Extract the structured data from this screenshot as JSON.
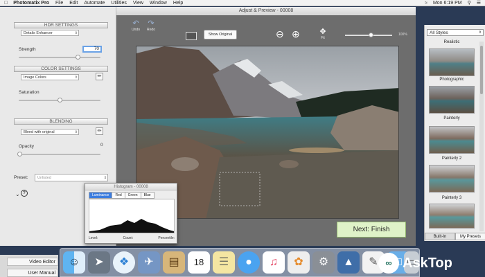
{
  "menubar": {
    "apple": "",
    "app_name": "Photomatix Pro",
    "items": [
      "File",
      "Edit",
      "Automate",
      "Utilities",
      "View",
      "Window",
      "Help"
    ],
    "clock": "Mon 6:19 PM"
  },
  "left_panel": {
    "hdr_settings_label": "HDR SETTINGS",
    "method_value": "Details Enhancer",
    "strength_label": "Strength",
    "strength_value": "70",
    "color_settings_label": "COLOR SETTINGS",
    "color_mode_value": "Image Colors",
    "saturation_label": "Saturation",
    "blending_label": "BLENDING",
    "blend_mode_value": "Blend with original",
    "opacity_label": "Opacity",
    "opacity_value": "0",
    "preset_label": "Preset:",
    "preset_value": "Unlisted",
    "help_icon": "?"
  },
  "main_window": {
    "title": "Adjust & Preview - 00008",
    "undo_label": "Undo",
    "redo_label": "Redo",
    "show_original_label": "Show Original",
    "fit_label": "Fit",
    "zoom_pct": "100%",
    "next_finish_label": "Next: Finish"
  },
  "histogram": {
    "title": "Histogram - 00008",
    "tabs": [
      "Luminance",
      "Red",
      "Green",
      "Blue"
    ],
    "footer": [
      "Level:",
      "Count:",
      "Percentile:"
    ]
  },
  "styles_panel": {
    "selector_value": "All Styles",
    "styles": [
      "Realistic",
      "Photographic",
      "Painterly",
      "Painterly 2",
      "Painterly 3"
    ],
    "tabs": [
      "Built-In",
      "My Presets"
    ]
  },
  "bottom_left": {
    "lines": [
      "Video Editor",
      "User Manual"
    ]
  },
  "dock": {
    "icons": [
      "finder-icon",
      "launchpad-icon",
      "safari-icon",
      "preview-icon",
      "notes-icon",
      "calendar-icon",
      "stickies-icon",
      "messages-icon",
      "music-icon",
      "photos-icon",
      "settings-icon",
      "photomatix-icon",
      "textedit-icon",
      "folder-icon",
      "trash-icon"
    ],
    "calendar_day": "18"
  },
  "watermark": {
    "text": "AskTop"
  }
}
